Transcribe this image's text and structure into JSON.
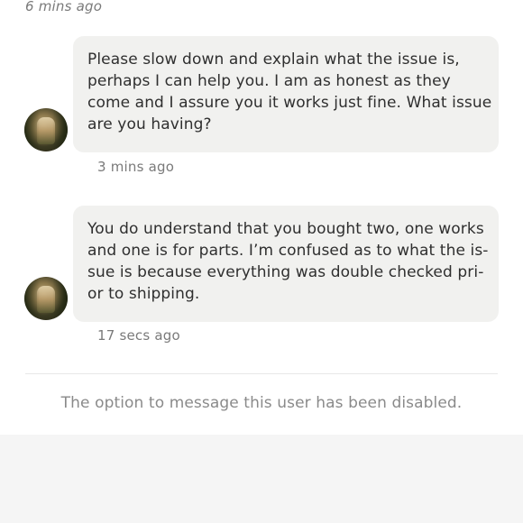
{
  "conversation": {
    "top_timestamp": "6 mins ago",
    "messages": [
      {
        "sender": "other",
        "lines": [
          "Please slow down and explain what the issue is,",
          "perhaps I can help you. I am as honest as they",
          "come and I assure you it works just fine. What issue",
          "are you having?"
        ],
        "timestamp": "3 mins ago"
      },
      {
        "sender": "other",
        "lines": [
          "You do understand that you bought two, one works",
          "and one is for parts. I’m confused as to what the is-",
          "sue is because everything was double checked pri-",
          "or to shipping."
        ],
        "timestamp": "17 secs ago"
      }
    ]
  },
  "notice": {
    "disabled_text": "The option to message this user has been disabled."
  },
  "colors": {
    "bubble_background": "#f1f1ef",
    "timestamp_text": "#7a7a7a",
    "notice_text": "#8a8a8a",
    "footer_background": "#f5f5f5"
  },
  "icons": {
    "avatar": "user-avatar-photo"
  }
}
